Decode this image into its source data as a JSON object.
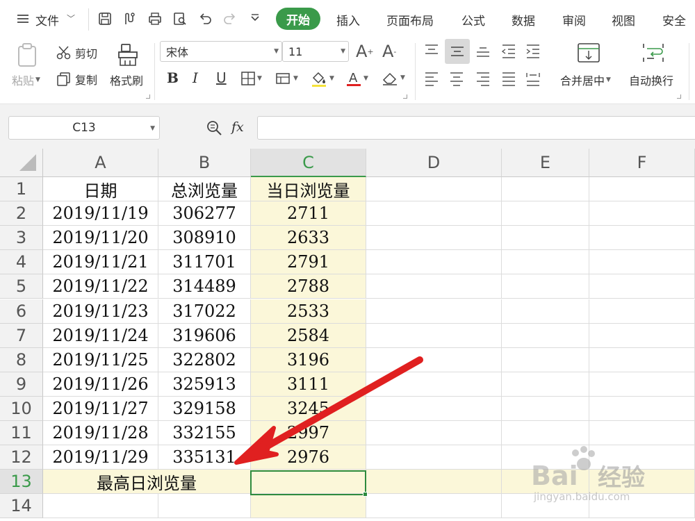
{
  "menu": {
    "file_label": "文件",
    "tabs": [
      "开始",
      "插入",
      "页面布局",
      "公式",
      "数据",
      "审阅",
      "视图",
      "安全"
    ]
  },
  "ribbon": {
    "paste": "粘贴",
    "cut": "剪切",
    "copy": "复制",
    "format_painter": "格式刷",
    "font_name": "宋体",
    "font_size": "11",
    "bold": "B",
    "italic": "I",
    "underline": "U",
    "merge_center": "合并居中",
    "wrap_text": "自动换行"
  },
  "formula_bar": {
    "name_box": "C13",
    "fx": "fx",
    "formula": ""
  },
  "sheet": {
    "columns": [
      "A",
      "B",
      "C",
      "D",
      "E",
      "F"
    ],
    "rows": [
      "1",
      "2",
      "3",
      "4",
      "5",
      "6",
      "7",
      "8",
      "9",
      "10",
      "11",
      "12",
      "13",
      "14"
    ],
    "header": [
      "日期",
      "总浏览量",
      "当日浏览量"
    ],
    "data": [
      [
        "2019/11/19",
        "306277",
        "2711"
      ],
      [
        "2019/11/20",
        "308910",
        "2633"
      ],
      [
        "2019/11/21",
        "311701",
        "2791"
      ],
      [
        "2019/11/22",
        "314489",
        "2788"
      ],
      [
        "2019/11/23",
        "317022",
        "2533"
      ],
      [
        "2019/11/24",
        "319606",
        "2584"
      ],
      [
        "2019/11/25",
        "322802",
        "3196"
      ],
      [
        "2019/11/26",
        "325913",
        "3111"
      ],
      [
        "2019/11/27",
        "329158",
        "3245"
      ],
      [
        "2019/11/28",
        "332155",
        "2997"
      ],
      [
        "2019/11/29",
        "335131",
        "2976"
      ]
    ],
    "row13_label": "最高日浏览量",
    "active_cell": "C13"
  },
  "watermark": {
    "brand": "Bai du",
    "cn": "经验",
    "url": "jingyan.baidu.com"
  },
  "colors": {
    "accent": "#3a9a4a",
    "highlight": "#fbf7d9",
    "arrow": "#e02020"
  }
}
